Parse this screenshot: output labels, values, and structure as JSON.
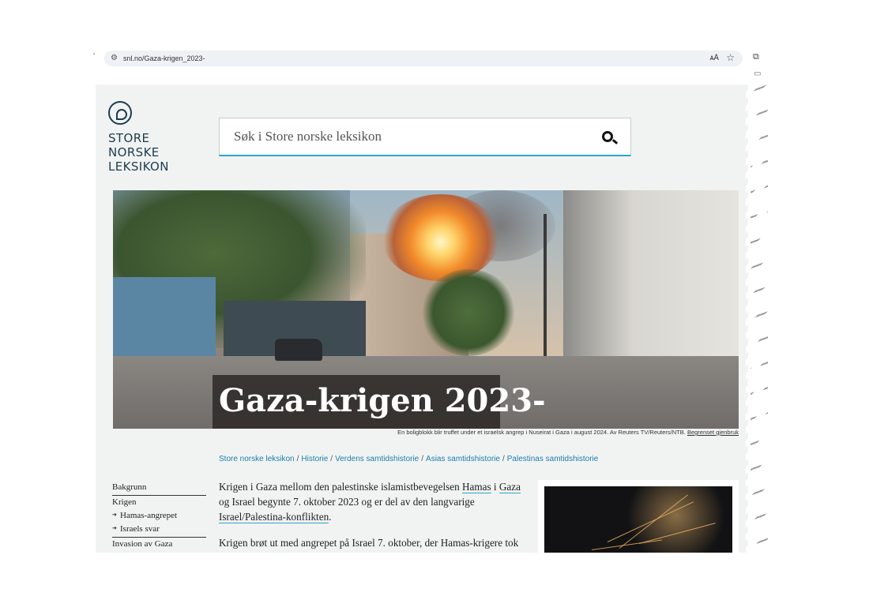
{
  "browser": {
    "url": "snl.no/Gaza-krigen_2023-"
  },
  "site": {
    "logo_lines": [
      "STORE",
      "NORSKE",
      "LEKSIKON"
    ]
  },
  "search": {
    "placeholder": "Søk i Store norske leksikon"
  },
  "hero": {
    "title": "Gaza-krigen 2023-",
    "caption": "En boligblokk blir truffet under et israelsk angrep i Nuseirat i Gaza i august 2024. Av Reuters TV/Reuters/NTB.",
    "caption_link": "Begrenset gjenbruk"
  },
  "breadcrumb": [
    "Store norske leksikon",
    "Historie",
    "Verdens samtidshistorie",
    "Asias samtidshistorie",
    "Palestinas samtidshistorie"
  ],
  "toc": {
    "items": [
      {
        "label": "Bakgrunn"
      },
      {
        "label": "Krigen"
      },
      {
        "label": "Hamas-angrepet"
      },
      {
        "label": "Israels svar"
      },
      {
        "label": "Invasion av Gaza"
      }
    ]
  },
  "article": {
    "p1_a": "Krigen i Gaza mellom den palestinske islamistbevegelsen ",
    "p1_link1": "Hamas",
    "p1_b": " i ",
    "p1_link2": "Gaza",
    "p1_c": " og Israel begynte 7. oktober 2023 og er del av den langvarige ",
    "p1_link3": "Israel/Palestina-konflikten",
    "p1_d": ".",
    "p2": "Krigen brøt ut med angrepet på Israel 7. oktober, der Hamas-krigere tok"
  },
  "colors": {
    "accent": "#2aa6c9",
    "link": "#1a7faa",
    "brand": "#1d3c4e"
  }
}
